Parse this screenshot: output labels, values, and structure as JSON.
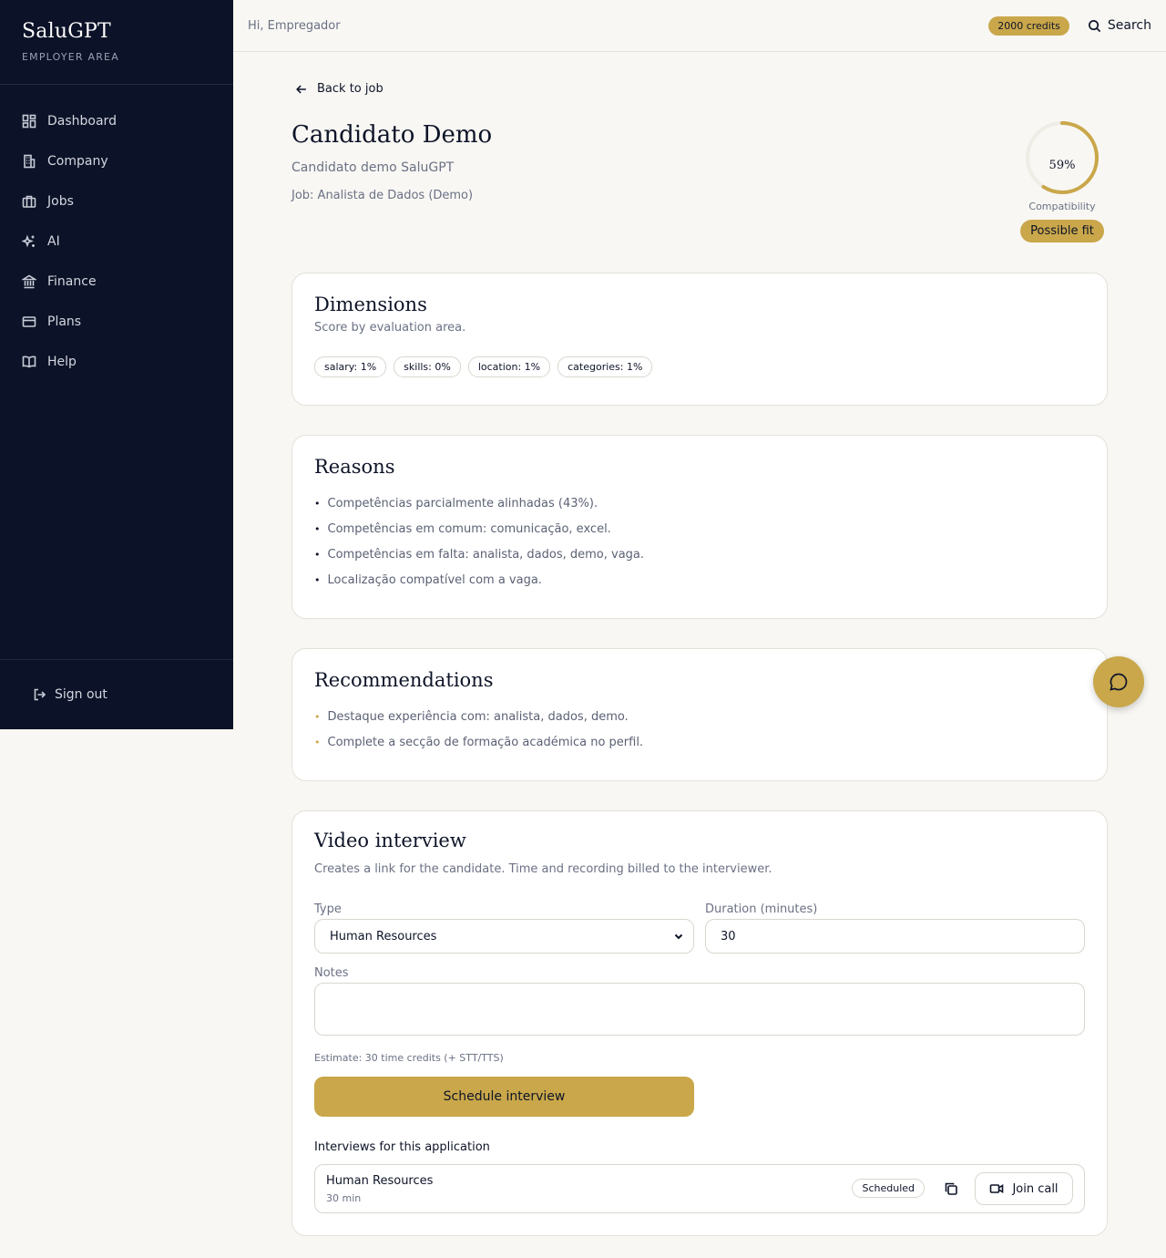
{
  "app": {
    "name": "SaluGPT",
    "area": "EMPLOYER AREA"
  },
  "sidebar": {
    "items": [
      {
        "label": "Dashboard",
        "icon": "dashboard-icon"
      },
      {
        "label": "Company",
        "icon": "building-icon"
      },
      {
        "label": "Jobs",
        "icon": "briefcase-icon"
      },
      {
        "label": "AI",
        "icon": "sparkles-icon"
      },
      {
        "label": "Finance",
        "icon": "bank-icon"
      },
      {
        "label": "Plans",
        "icon": "credit-card-icon"
      },
      {
        "label": "Help",
        "icon": "book-icon"
      }
    ],
    "signout": "Sign out"
  },
  "topbar": {
    "greeting": "Hi, Empregador",
    "credits": "2000 credits",
    "search": "Search"
  },
  "back": "Back to job",
  "candidate": {
    "name": "Candidato Demo",
    "subtitle": "Candidato demo SaluGPT",
    "job": "Job: Analista de Dados (Demo)"
  },
  "score": {
    "value": "59%",
    "fraction": 0.59,
    "label": "Compatibility",
    "badge": "Possible fit"
  },
  "dimensions": {
    "title": "Dimensions",
    "desc": "Score by evaluation area.",
    "chips": [
      "salary: 1%",
      "skills: 0%",
      "location: 1%",
      "categories: 1%"
    ]
  },
  "reasons": {
    "title": "Reasons",
    "items": [
      "Competências parcialmente alinhadas (43%).",
      "Competências em comum: comunicação, excel.",
      "Competências em falta: analista, dados, demo, vaga.",
      "Localização compatível com a vaga."
    ]
  },
  "recommendations": {
    "title": "Recommendations",
    "items": [
      "Destaque experiência com: analista, dados, demo.",
      "Complete a secção de formação académica no perfil."
    ]
  },
  "video": {
    "title": "Video interview",
    "desc": "Creates a link for the candidate. Time and recording billed to the interviewer.",
    "type_label": "Type",
    "type_value": "Human Resources",
    "duration_label": "Duration (minutes)",
    "duration_value": "30",
    "notes_label": "Notes",
    "notes_value": "",
    "estimate": "Estimate: 30 time credits (+ STT/TTS)",
    "schedule": "Schedule interview",
    "list_title": "Interviews for this application",
    "interviews": [
      {
        "title": "Human Resources",
        "duration": "30 min",
        "status": "Scheduled",
        "join": "Join call"
      }
    ]
  },
  "colors": {
    "sidebar": "#0c1227",
    "accent": "#c9a74a",
    "background": "#f8f7f3"
  }
}
